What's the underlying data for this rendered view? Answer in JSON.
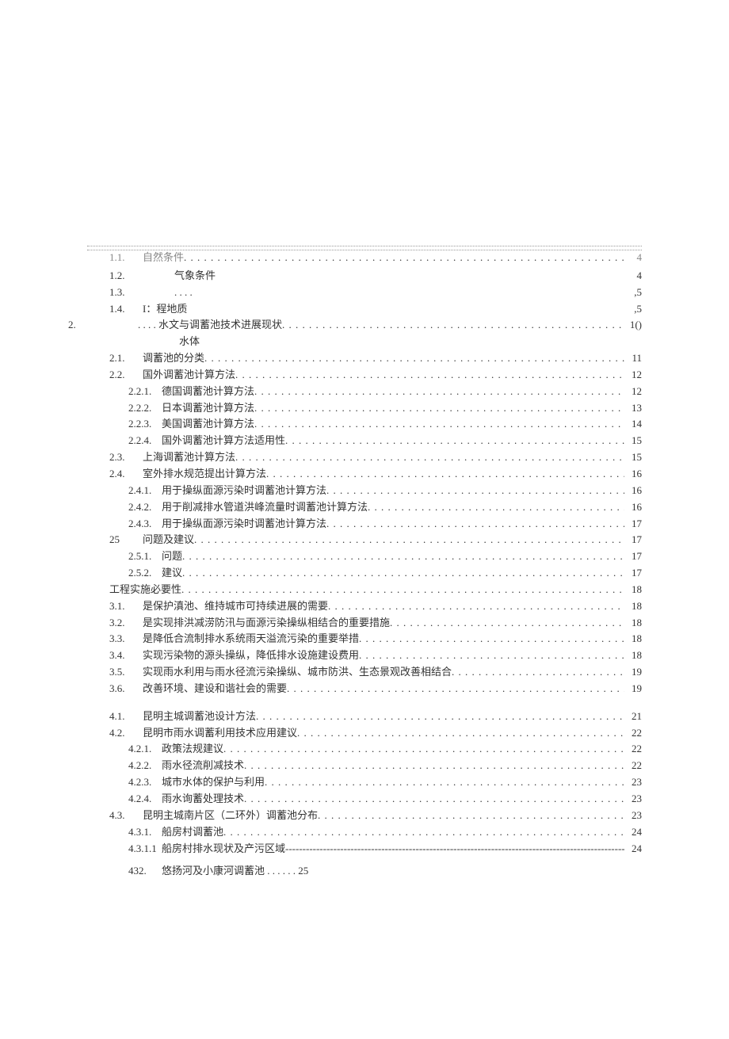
{
  "toc": [
    {
      "n": "1.1.",
      "t": "自然条件",
      "p": "4",
      "ind": 1,
      "style": "topline faded",
      "leader": "leader"
    },
    {
      "n": "1.2.",
      "t": "气象条件",
      "p": "4",
      "ind": 1,
      "leader": "leader-none",
      "titlePad": 40
    },
    {
      "n": "1.3.",
      "t": ". . . .",
      "p": ",5",
      "ind": 1,
      "leader": "leader-none",
      "titlePad": 40
    },
    {
      "n": "1.4.",
      "t": "I：程地质",
      "p": ",5",
      "ind": 1,
      "leader": "leader-none"
    },
    {
      "n": "2.",
      "t": ". . . . 水文与调蓄池技术进展现状",
      "p": "1()",
      "ind": 0,
      "leader": "leader",
      "leftMarker": true,
      "sub": "水体"
    },
    {
      "n": "2.1.",
      "t": "调蓄池的分类",
      "p": "11",
      "ind": 1,
      "leader": "leader"
    },
    {
      "n": "2.2.",
      "t": "国外调蓄池计算方法",
      "p": "12",
      "ind": 1,
      "leader": "leader"
    },
    {
      "n": "2.2.1.",
      "t": "德国调蓄池计算方法",
      "p": "12",
      "ind": 2,
      "leader": "leader"
    },
    {
      "n": "2.2.2.",
      "t": "日本调蓄池计算方法",
      "p": "13",
      "ind": 2,
      "leader": "leader"
    },
    {
      "n": "2.2.3.",
      "t": "美国调蓄池计算方法",
      "p": "14",
      "ind": 2,
      "leader": "leader"
    },
    {
      "n": "2.2.4.",
      "t": "国外调蓄池计算方法适用性",
      "p": "15",
      "ind": 2,
      "leader": "leader"
    },
    {
      "n": "2.3.",
      "t": "上海调蓄池计算方法",
      "p": "15",
      "ind": 1,
      "leader": "leader"
    },
    {
      "n": "2.4.",
      "t": "室外排水规范提出计算方法",
      "p": "16",
      "ind": 1,
      "leader": "leader"
    },
    {
      "n": "2.4.1.",
      "t": "用于操纵面源污染时调蓄池计算方法",
      "p": "16",
      "ind": 2,
      "leader": "leader"
    },
    {
      "n": "2.4.2.",
      "t": "用于削减排水管道洪峰流量时调蓄池计算方法",
      "p": "16",
      "ind": 2,
      "leader": "leader"
    },
    {
      "n": "2.4.3.",
      "t": "用于操纵面源污染时调蓄池计算方法",
      "p": "17",
      "ind": 2,
      "leader": "leader"
    },
    {
      "n": "25",
      "t": "问题及建议",
      "p": "17",
      "ind": 1,
      "leader": "leader"
    },
    {
      "n": "2.5.1.",
      "t": "问题",
      "p": "17",
      "ind": 2,
      "leader": "leader"
    },
    {
      "n": "2.5.2.",
      "t": "建议",
      "p": "17",
      "ind": 2,
      "leader": "leader"
    },
    {
      "n": "",
      "t": "工程实施必要性",
      "p": "18",
      "ind": 1,
      "leader": "leader",
      "noNum": true
    },
    {
      "n": "3.1.",
      "t": "是保护滇池、维持城市可持续进展的需要",
      "p": "18",
      "ind": 1,
      "leader": "leader"
    },
    {
      "n": "3.2.",
      "t": "是实现排洪减涝防汛与面源污染操纵相结合的重要措施",
      "p": "18",
      "ind": 1,
      "leader": "leader"
    },
    {
      "n": "3.3.",
      "t": "是降低合流制排水系统雨天溢流污染的重要举措",
      "p": "18",
      "ind": 1,
      "leader": "leader"
    },
    {
      "n": "3.4.",
      "t": "实现污染物的源头操纵，降低排水设施建设费用",
      "p": "18",
      "ind": 1,
      "leader": "leader"
    },
    {
      "n": "3.5.",
      "t": "实现雨水利用与雨水径流污染操纵、城市防洪、生态景观改善相结合",
      "p": "19",
      "ind": 1,
      "leader": "leader"
    },
    {
      "n": "3.6.",
      "t": "改善环境、建设和谐社会的需要",
      "p": "19",
      "ind": 1,
      "leader": "leader"
    },
    {
      "gap": true
    },
    {
      "n": "4.1.",
      "t": "昆明主城调蓄池设计方法",
      "p": "21",
      "ind": 1,
      "leader": "leader"
    },
    {
      "n": "4.2.",
      "t": "昆明市雨水调蓄利用技术应用建议",
      "p": "22",
      "ind": 1,
      "leader": "leader"
    },
    {
      "n": "4.2.1.",
      "t": "政策法规建议",
      "p": "22",
      "ind": 2,
      "leader": "leader"
    },
    {
      "n": "4.2.2.",
      "t": "雨水径流削减技术",
      "p": "22",
      "ind": 2,
      "leader": "leader"
    },
    {
      "n": "4.2.3.",
      "t": "城市水体的保护与利用",
      "p": "23",
      "ind": 2,
      "leader": "leader"
    },
    {
      "n": "4.2.4.",
      "t": "雨水询蓄处理技术",
      "p": "23",
      "ind": 2,
      "leader": "leader"
    },
    {
      "n": "4.3.",
      "t": "昆明主城南片区（二环外）调蓄池分布",
      "p": "23",
      "ind": 1,
      "leader": "leader"
    },
    {
      "n": "4.3.1.",
      "t": "船房村调蓄池",
      "p": "24",
      "ind": 2,
      "leader": "leader"
    },
    {
      "n": "4.3.1.1",
      "t": "船房村排水现状及产污区域",
      "p": "24",
      "ind": 2,
      "leader": "leader-dash"
    },
    {
      "gap": true,
      "small": true
    },
    {
      "n": "432.",
      "t": "悠扬河及小康河调蓄池 . . . . . . 25",
      "p": "",
      "ind": 2,
      "leader": "leader-none",
      "noPg": true
    }
  ]
}
